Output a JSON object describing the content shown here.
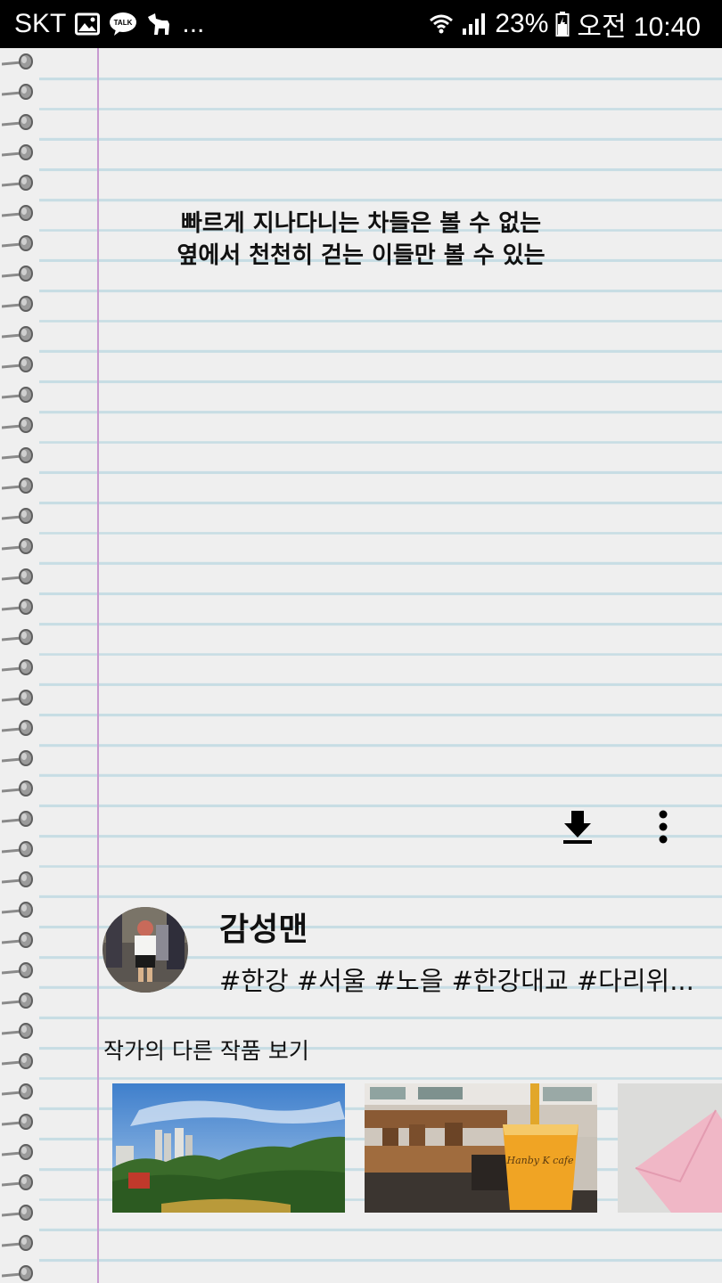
{
  "status_bar": {
    "carrier": "SKT",
    "overflow": "...",
    "battery": "23%",
    "time": "오전 10:40",
    "icons": [
      "gallery-icon",
      "kakaotalk-icon",
      "dog-icon",
      "wifi-icon",
      "signal-icon",
      "battery-icon"
    ]
  },
  "post": {
    "quote_lines": [
      "빠르게 지나다니는 차들은 볼 수 없는",
      "옆에서 천천히 걷는 이들만 볼 수 있는"
    ],
    "actions": [
      "download-icon",
      "more-vert-icon"
    ]
  },
  "author": {
    "name": "감성맨",
    "tags": "#한강 #서울 #노을 #한강대교 #다리위..."
  },
  "more_works": {
    "title": "작가의 다른 작품 보기",
    "thumbnails": [
      "park-photo",
      "cafe-drink-photo",
      "pink-envelope-photo"
    ]
  },
  "colors": {
    "paper": "#efefef",
    "rule_line": "#c7dde4",
    "margin_line": "#c79ad0",
    "status_bar": "#000000"
  }
}
